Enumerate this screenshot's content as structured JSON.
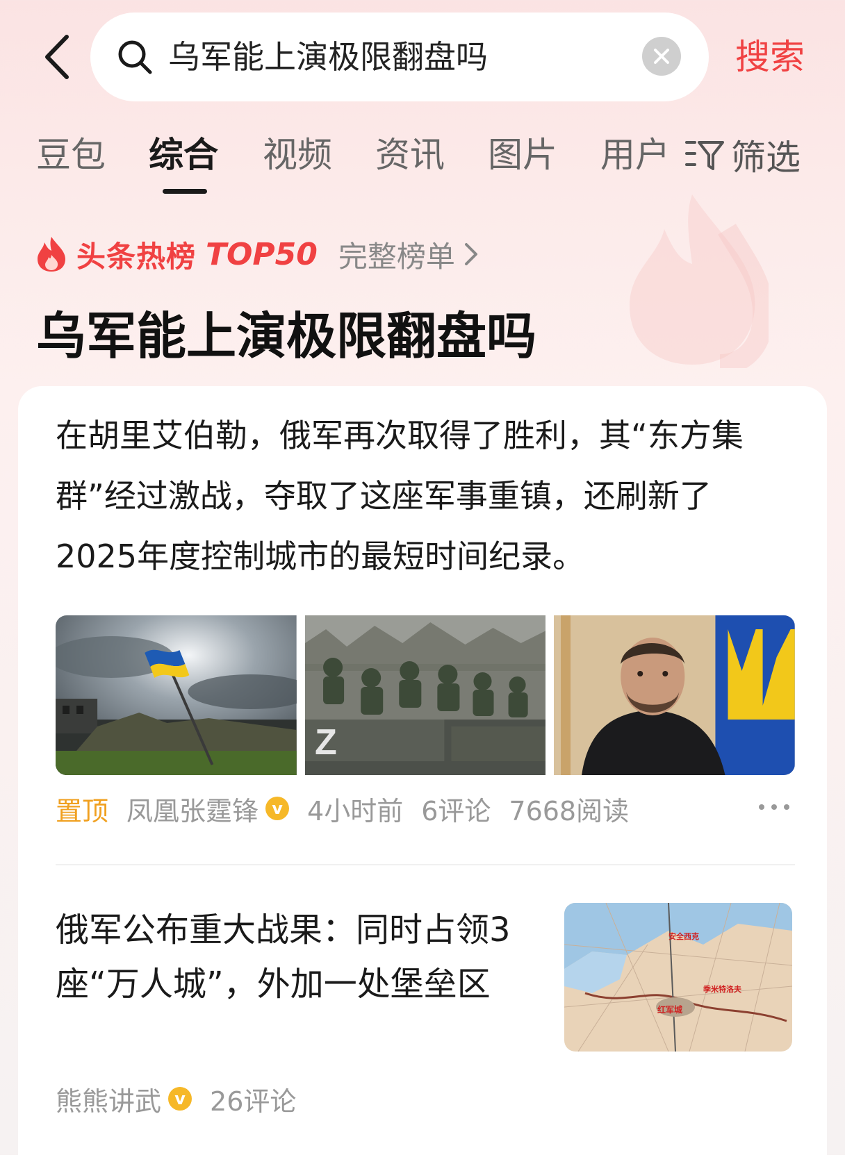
{
  "search": {
    "query": "乌军能上演极限翻盘吗",
    "action_label": "搜索"
  },
  "tabs": [
    {
      "label": "豆包",
      "active": false
    },
    {
      "label": "综合",
      "active": true
    },
    {
      "label": "视频",
      "active": false
    },
    {
      "label": "资讯",
      "active": false
    },
    {
      "label": "图片",
      "active": false
    },
    {
      "label": "用户",
      "active": false
    }
  ],
  "filter_label": "筛选",
  "hot_list": {
    "title": "头条热榜",
    "rank_label": "TOP50",
    "full_list_label": "完整榜单",
    "topic": "乌军能上演极限翻盘吗"
  },
  "articles": [
    {
      "text": "在胡里艾伯勒，俄军再次取得了胜利，其“东方集群”经过激战，夺取了这座军事重镇，还刷新了2025年度控制城市的最短时间纪录。",
      "pin_label": "置顶",
      "author": "凤凰张霆锋",
      "verified_label": "v",
      "time": "4小时前",
      "comments": "6评论",
      "reads": "7668阅读"
    },
    {
      "text": "俄军公布重大战果：同时占领3座“万人城”，外加一处堡垒区",
      "author": "熊熊讲武",
      "verified_label": "v",
      "comments": "26评论",
      "map_labels": [
        "安全西克",
        "季米特洛夫",
        "红军城"
      ]
    }
  ],
  "colors": {
    "accent": "#f04142",
    "pin": "#f0a020",
    "verified": "#f6b828"
  }
}
